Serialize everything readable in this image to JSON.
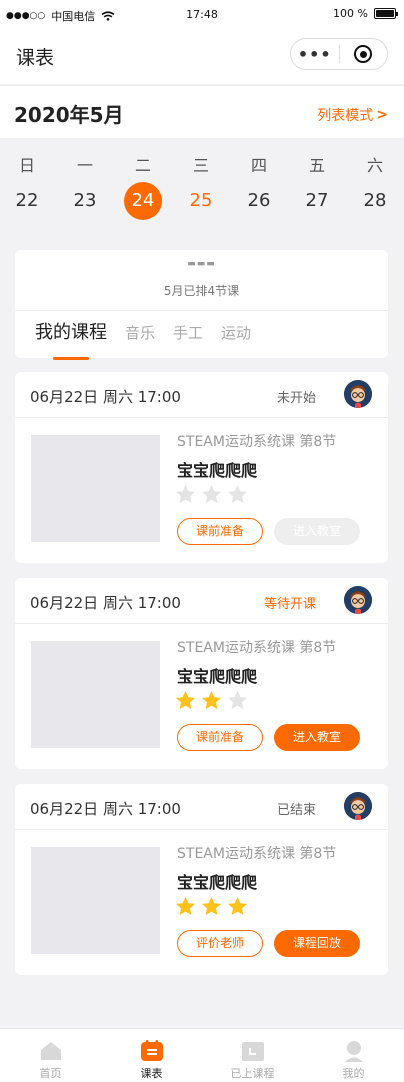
{
  "status_bar": {
    "carrier": "中国电信",
    "time": "17:48",
    "battery": "100 %"
  },
  "nav": {
    "title": "课表"
  },
  "header": {
    "month": "2020年5月",
    "list_mode": "列表模式"
  },
  "week": {
    "labels": [
      "日",
      "一",
      "二",
      "三",
      "四",
      "五",
      "六"
    ],
    "days": [
      "22",
      "23",
      "24",
      "25",
      "26",
      "27",
      "28"
    ],
    "selected_index": 2
  },
  "summary": {
    "text": "5月已排4节课"
  },
  "tabs": [
    "我的课程",
    "音乐",
    "手工",
    "运动"
  ],
  "courses": [
    {
      "date": "06月22日 周六 17:00",
      "status": "未开始",
      "subtitle": "STEAM运动系统课 第8节",
      "name": "宝宝爬爬爬",
      "stars_filled": 0,
      "btn1": "课前准备",
      "btn2": "进入教室"
    },
    {
      "date": "06月22日 周六 17:00",
      "status": "等待开课",
      "subtitle": "STEAM运动系统课 第8节",
      "name": "宝宝爬爬爬",
      "stars_filled": 2,
      "btn1": "课前准备",
      "btn2": "进入教室"
    },
    {
      "date": "06月22日 周六 17:00",
      "status": "已结束",
      "subtitle": "STEAM运动系统课 第8节",
      "name": "宝宝爬爬爬",
      "stars_filled": 3,
      "btn1": "评价老师",
      "btn2": "课程回放"
    }
  ],
  "tab_bar": [
    {
      "label": "首页",
      "icon": "home-icon"
    },
    {
      "label": "课表",
      "icon": "schedule-icon"
    },
    {
      "label": "已上课程",
      "icon": "finished-courses-icon"
    },
    {
      "label": "我的",
      "icon": "profile-icon"
    }
  ],
  "colors": {
    "accent": "#ff6a00",
    "star_on": "#ffc21a",
    "star_off": "#e4e4e4"
  }
}
